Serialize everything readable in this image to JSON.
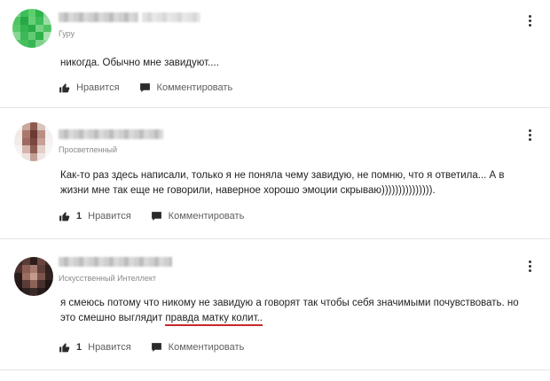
{
  "answers": [
    {
      "rank": "Гуру",
      "text": "никогда. Обычно мне завидуют....",
      "text_highlight": "",
      "text_after": "",
      "likes": "",
      "like_label": "Нравится",
      "comment_label": "Комментировать",
      "avatar_colors": [
        "#7fd18b",
        "#3bbf5a",
        "#5ccf6d",
        "#2fb34c",
        "#8bd896",
        "#4ec463",
        "#25a845",
        "#68cf79",
        "#3fbc59",
        "#9bdda5",
        "#59c96b",
        "#34b550",
        "#2aa947",
        "#74d383",
        "#4fc265",
        "#86d792",
        "#3db858",
        "#62cc73",
        "#2fb14b",
        "#a8e2b1",
        "#57c568",
        "#47bf5f",
        "#38b654",
        "#7ed38c",
        "#92d99d"
      ]
    },
    {
      "rank": "Просветленный",
      "text": "Как-то раз здесь написали, только я не поняла чему завидую, не помню, что я ответила... А в жизни мне так еще не говорили, наверное хорошо эмоции скрываю))))))))))))))).",
      "text_highlight": "",
      "text_after": "",
      "likes": "1",
      "like_label": "Нравится",
      "comment_label": "Комментировать",
      "avatar_colors": [
        "#f4f1ef",
        "#c9a79c",
        "#8c5a4f",
        "#d8c4bd",
        "#f7f5f4",
        "#efe9e7",
        "#a9776b",
        "#6b3a33",
        "#bb8e83",
        "#f3efee",
        "#f1ecea",
        "#9c6a5e",
        "#7a4840",
        "#c7a197",
        "#f5f2f1",
        "#f6f3f2",
        "#d4b6ae",
        "#8f5e53",
        "#e2cfc9",
        "#f8f6f5",
        "#f8f7f6",
        "#ece3e0",
        "#c3a096",
        "#efe7e4",
        "#f9f8f7"
      ]
    },
    {
      "rank": "Искусственный Интеллект",
      "text": "я смеюсь потому что никому не завидую а говорят так чтобы себя значимыми почувствовать. но это смешно выглядит ",
      "text_highlight": "правда матку колит..",
      "text_after": "",
      "likes": "1",
      "like_label": "Нравится",
      "comment_label": "Комментировать",
      "avatar_colors": [
        "#3a2a28",
        "#5a3a36",
        "#2b1e1d",
        "#6a4640",
        "#3f2c2a",
        "#4d322f",
        "#8a5e55",
        "#a77a6e",
        "#5c3d38",
        "#2e2120",
        "#2a1d1c",
        "#9b6e62",
        "#c49b8c",
        "#7d544b",
        "#332423",
        "#241918",
        "#5a3c37",
        "#8d6257",
        "#47302d",
        "#1f1615",
        "#1c1413",
        "#2d201f",
        "#3b2a28",
        "#281c1b",
        "#191211"
      ]
    }
  ],
  "icons": {
    "like": "thumbs-up-icon",
    "comment": "speech-bubble-icon",
    "more": "vertical-ellipsis-icon"
  },
  "colors": {
    "highlight_underline": "#c62828",
    "meta_text": "#5f5f5f"
  }
}
